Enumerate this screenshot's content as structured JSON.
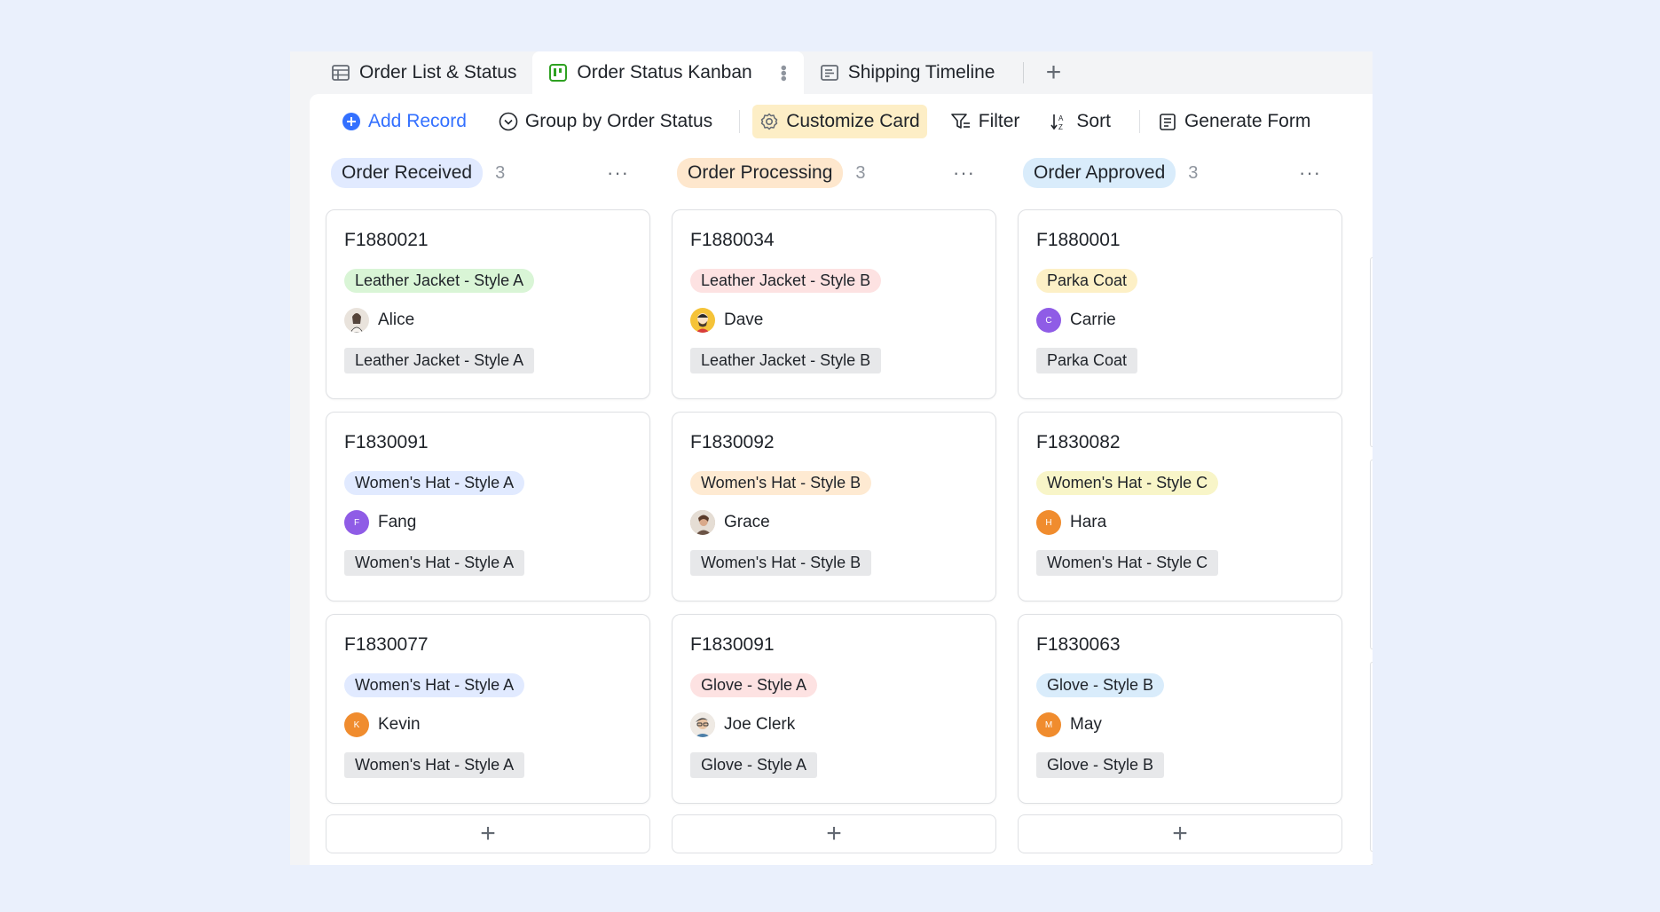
{
  "tabs": [
    {
      "label": "Order List & Status",
      "icon": "table-icon"
    },
    {
      "label": "Order Status Kanban",
      "icon": "kanban-icon"
    },
    {
      "label": "Shipping Timeline",
      "icon": "timeline-icon"
    }
  ],
  "add_tab_label": "+",
  "toolbar": {
    "add_record": "Add Record",
    "group_by_prefix": "Group by ",
    "group_by_field": "Order Status",
    "customize_card": "Customize Card",
    "filter": "Filter",
    "sort": "Sort",
    "generate_form": "Generate Form"
  },
  "colors": {
    "accent": "#3370ff",
    "kanban_icon": "#2ea121"
  },
  "columns": [
    {
      "title": "Order Received",
      "count": "3",
      "pill_color": "#e1eaff",
      "cards": [
        {
          "id": "F1880021",
          "tag": "Leather Jacket - Style A",
          "tag_color": "#d9f5d6",
          "person": "Alice",
          "avatar": "photo-avatar",
          "avatar_color": "#e9e3dc",
          "avatar_letter": "",
          "field": "Leather Jacket - Style A"
        },
        {
          "id": "F1830091",
          "tag": "Women's Hat - Style A",
          "tag_color": "#e1eaff",
          "person": "Fang",
          "avatar": "letter-avatar",
          "avatar_color": "#8f5ce6",
          "avatar_letter": "F",
          "field": "Women's Hat - Style A"
        },
        {
          "id": "F1830077",
          "tag": "Women's Hat - Style A",
          "tag_color": "#e1eaff",
          "person": "Kevin",
          "avatar": "letter-avatar",
          "avatar_color": "#f08c2e",
          "avatar_letter": "K",
          "field": "Women's Hat - Style A"
        }
      ]
    },
    {
      "title": "Order Processing",
      "count": "3",
      "pill_color": "#fee7cd",
      "cards": [
        {
          "id": "F1880034",
          "tag": "Leather Jacket - Style B",
          "tag_color": "#fde2e2",
          "person": "Dave",
          "avatar": "photo-avatar",
          "avatar_color": "#f5c338",
          "avatar_letter": "",
          "field": "Leather Jacket - Style B"
        },
        {
          "id": "F1830092",
          "tag": "Women's Hat - Style B",
          "tag_color": "#feead2",
          "person": "Grace",
          "avatar": "photo-avatar",
          "avatar_color": "#c9b8a8",
          "avatar_letter": "",
          "field": "Women's Hat - Style B"
        },
        {
          "id": "F1830091",
          "tag": "Glove - Style A",
          "tag_color": "#fde2e2",
          "person": "Joe Clerk",
          "avatar": "photo-avatar",
          "avatar_color": "#d8d4cf",
          "avatar_letter": "",
          "field": "Glove - Style A"
        }
      ]
    },
    {
      "title": "Order Approved",
      "count": "3",
      "pill_color": "#d9ecfb",
      "cards": [
        {
          "id": "F1880001",
          "tag": "Parka Coat",
          "tag_color": "#fdf0c6",
          "person": "Carrie",
          "avatar": "letter-avatar",
          "avatar_color": "#8f5ce6",
          "avatar_letter": "C",
          "field": "Parka Coat"
        },
        {
          "id": "F1830082",
          "tag": "Women's Hat - Style C",
          "tag_color": "#f8f5c8",
          "person": "Hara",
          "avatar": "letter-avatar",
          "avatar_color": "#f08c2e",
          "avatar_letter": "H",
          "field": "Women's Hat - Style C"
        },
        {
          "id": "F1830063",
          "tag": "Glove - Style B",
          "tag_color": "#d9ecfb",
          "person": "May",
          "avatar": "letter-avatar",
          "avatar_color": "#f08c2e",
          "avatar_letter": "M",
          "field": "Glove - Style B"
        }
      ]
    }
  ]
}
